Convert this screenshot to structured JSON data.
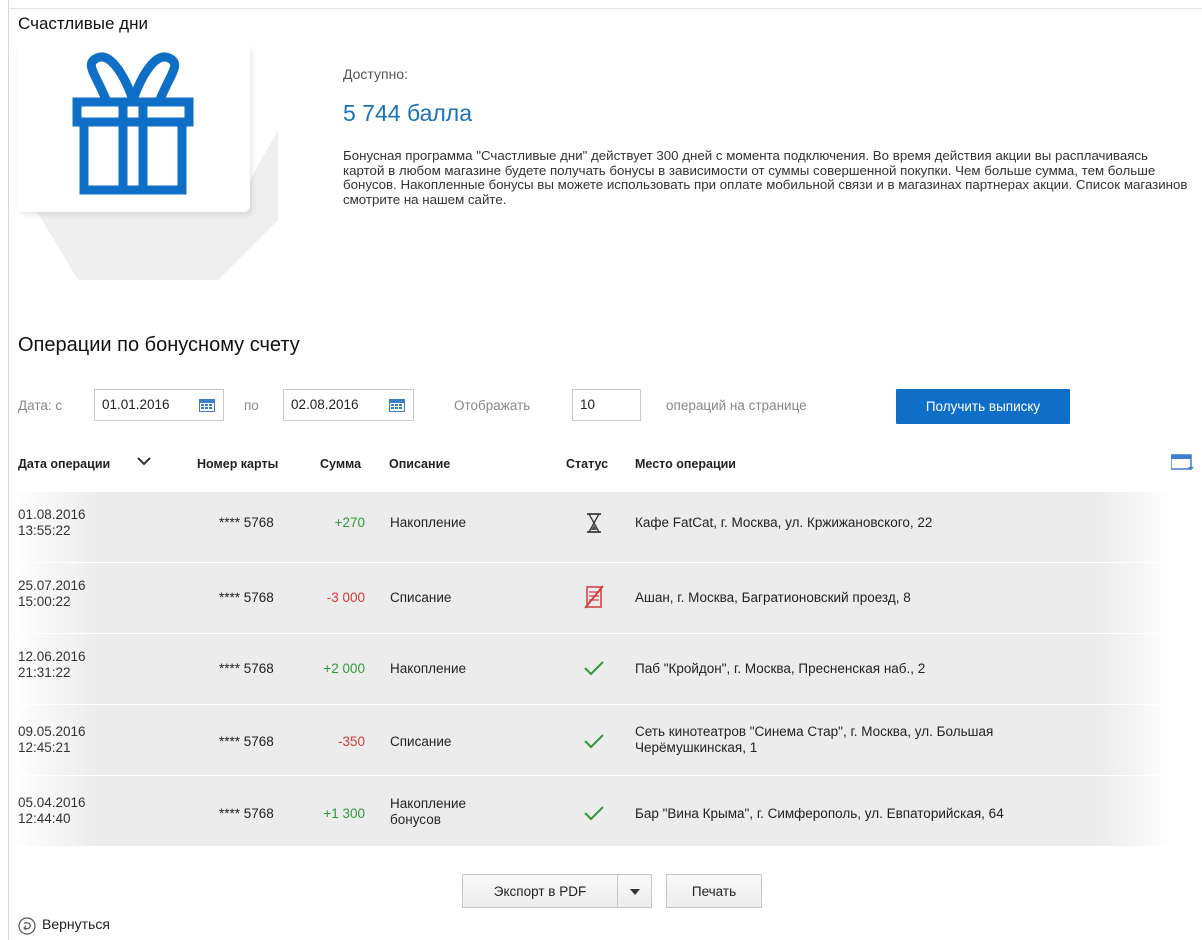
{
  "page": {
    "title": "Счастливые дни"
  },
  "bonus": {
    "available_label": "Доступно:",
    "available_value": "5 744 балла",
    "description": "Бонусная программа \"Счастливые дни\" действует 300 дней с момента подключения. Во время действия акции вы расплачиваясь картой в любом магазине будете получать бонусы в зависимости от суммы совершенной покупки. Чем больше сумма, тем больше бонусов. Накопленные бонусы вы можете использовать при оплате мобильной связи и в магазинах партнерах акции. Список магазинов смотрите на нашем сайте."
  },
  "operations": {
    "title": "Операции по бонусному счету",
    "filter": {
      "date_from_label": "Дата: с",
      "date_from": "01.01.2016",
      "date_to_label": "по",
      "date_to": "02.08.2016",
      "show_label": "Отображать",
      "page_size": "10",
      "per_page_label": "операций на странице",
      "submit": "Получить выписку"
    },
    "columns": {
      "date": "Дата операции",
      "card": "Номер карты",
      "amount": "Сумма",
      "description": "Описание",
      "status": "Статус",
      "place": "Место операции"
    },
    "rows": [
      {
        "date": "01.08.2016",
        "time": "13:55:22",
        "card": "**** 5768",
        "amount": "+270",
        "type": "credit",
        "description": "Накопление",
        "description2": "",
        "status": "hourglass-icon",
        "place": "Кафе FatCat, г. Москва, ул. Кржижановского, 22",
        "place2": ""
      },
      {
        "date": "25.07.2016",
        "time": "15:00:22",
        "card": "**** 5768",
        "amount": "-3 000",
        "type": "debit",
        "description": "Списание",
        "description2": "",
        "status": "declined-icon",
        "place": "Ашан, г. Москва, Багратионовский проезд, 8",
        "place2": ""
      },
      {
        "date": "12.06.2016",
        "time": "21:31:22",
        "card": "**** 5768",
        "amount": "+2 000",
        "type": "credit",
        "description": "Накопление",
        "description2": "",
        "status": "check-icon",
        "place": "Паб \"Кройдон\", г. Москва, Пресненская наб., 2",
        "place2": ""
      },
      {
        "date": "09.05.2016",
        "time": "12:45:21",
        "card": "**** 5768",
        "amount": "-350",
        "type": "debit",
        "description": "Списание",
        "description2": "",
        "status": "check-icon",
        "place": "Сеть кинотеатров \"Синема Стар\", г. Москва, ул. Большая",
        "place2": "Черёмушкинская, 1"
      },
      {
        "date": "05.04.2016",
        "time": "12:44:40",
        "card": "**** 5768",
        "amount": "+1 300",
        "type": "credit",
        "description": "Накопление",
        "description2": "бонусов",
        "status": "check-icon",
        "place": "Бар \"Вина Крыма\", г. Симферополь, ул. Евпаторийская, 64",
        "place2": ""
      }
    ]
  },
  "actions": {
    "export": "Экспорт в PDF",
    "print": "Печать",
    "back": "Вернуться"
  },
  "colors": {
    "accent": "#0f6fc6",
    "credit": "#2f9a3a",
    "debit": "#d33a3a",
    "gift": "#0f6fc6"
  }
}
